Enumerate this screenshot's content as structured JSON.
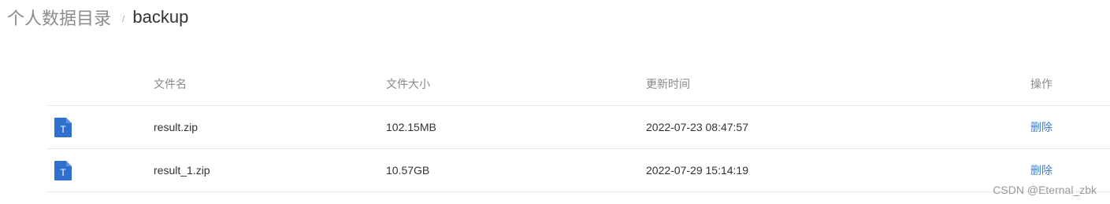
{
  "breadcrumb": {
    "root": "个人数据目录",
    "separator": "/",
    "current": "backup"
  },
  "table": {
    "headers": {
      "name": "文件名",
      "size": "文件大小",
      "updated": "更新时间",
      "actions": "操作"
    },
    "rows": [
      {
        "icon": "file-icon",
        "name": "result.zip",
        "size": "102.15MB",
        "updated": "2022-07-23 08:47:57",
        "action": "删除"
      },
      {
        "icon": "file-icon",
        "name": "result_1.zip",
        "size": "10.57GB",
        "updated": "2022-07-29 15:14:19",
        "action": "删除"
      }
    ]
  },
  "watermark": "CSDN @Eternal_zbk",
  "colors": {
    "link": "#3d7fd6",
    "file_icon": "#2f6fd0",
    "header_text": "#888888",
    "row_divider": "#e8e8e8"
  }
}
